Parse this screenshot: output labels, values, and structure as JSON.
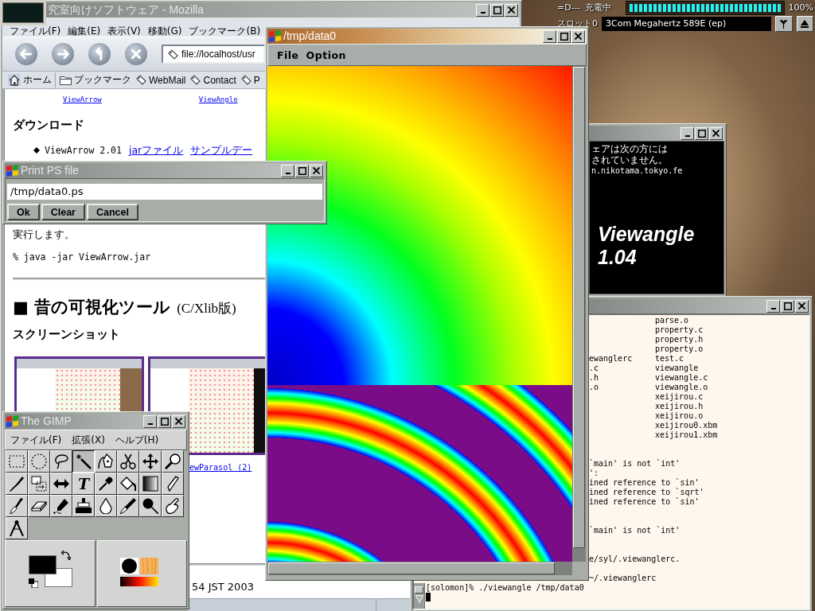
{
  "desktop": {
    "battery": {
      "label": "=D---",
      "status": "充電中",
      "level": 1,
      "reading": "100%"
    },
    "card_slot": {
      "label": "スロット0",
      "value": "3Com Megahertz 589E (ep)"
    }
  },
  "browser": {
    "title": "究室向けソフトウェア - Mozilla",
    "active": false,
    "menu": [
      "ファイル(F)",
      "編集(E)",
      "表示(V)",
      "移動(G)",
      "ブックマーク(B)"
    ],
    "url": "file://localhost/usr",
    "personal_toolbar": [
      {
        "label": "ホーム",
        "kind": "home"
      },
      {
        "label": "ブックマーク",
        "kind": "folder"
      },
      {
        "label": "WebMail",
        "kind": "bookmark"
      },
      {
        "label": "Contact",
        "kind": "bookmark"
      },
      {
        "label": "P",
        "kind": "bookmark"
      }
    ],
    "page": {
      "top_links": [
        "ViewArrow",
        "ViewAngle"
      ],
      "download_heading": "ダウンロード",
      "downloads": [
        {
          "name": "ViewArrow 2.01",
          "links": [
            "jarファイル",
            "サンプルデー"
          ]
        }
      ],
      "paragraph_end": "実行します。",
      "command": "% java -jar ViewArrow.jar",
      "section_heading": "■ 昔の可視化ツール",
      "section_heading_note": "(C/Xlib版)",
      "screenshots_heading": "スクリーンショット",
      "thumbnail_caption": "ewParasol (2)",
      "footer_fragment": "54 JST 2003"
    }
  },
  "splash": {
    "active": false,
    "lines": [
      "ェアは次の方には",
      "されていません。",
      "n.nikotama.tokyo.fe"
    ],
    "product": "Viewangle",
    "version": "1.04"
  },
  "terminal": {
    "active": false,
    "lines": [
      {
        "kind": "listing",
        "column_2": "parse.o"
      },
      {
        "kind": "listing",
        "column_2": "property.c"
      },
      {
        "kind": "listing",
        "column_2": "property.h"
      },
      {
        "kind": "listing",
        "column_2": "property.o"
      },
      {
        "kind": "listing",
        "column_1": "ewanglerc",
        "column_2": "test.c"
      },
      {
        "kind": "listing",
        "column_1": ".c",
        "column_2": "viewangle"
      },
      {
        "kind": "listing",
        "column_1": ".h",
        "column_2": "viewangle.c"
      },
      {
        "kind": "listing",
        "column_1": ".o",
        "column_2": "viewangle.o"
      },
      {
        "kind": "listing",
        "column_2": "xeijirou.c"
      },
      {
        "kind": "listing",
        "column_2": "xeijirou.h"
      },
      {
        "kind": "listing",
        "column_2": "xeijirou.o"
      },
      {
        "kind": "listing",
        "column_2": "xeijirou0.xbm"
      },
      {
        "kind": "listing",
        "column_2": "xeijirou1.xbm"
      },
      {
        "kind": "blank"
      },
      {
        "kind": "blank"
      },
      {
        "kind": "text",
        "text": "`main' is not `int'"
      },
      {
        "kind": "text",
        "text": "':"
      },
      {
        "kind": "text",
        "text": "ined reference to `sin'"
      },
      {
        "kind": "text",
        "text": "ined reference to `sqrt'"
      },
      {
        "kind": "text",
        "text": "ined reference to `sin'"
      },
      {
        "kind": "blank"
      },
      {
        "kind": "blank"
      },
      {
        "kind": "text",
        "text": "`main' is not `int'"
      },
      {
        "kind": "blank"
      },
      {
        "kind": "blank"
      },
      {
        "kind": "text",
        "text": "e/syl/.viewanglerc."
      },
      {
        "kind": "blank"
      },
      {
        "kind": "text",
        "text": "~/.viewanglerc"
      },
      {
        "kind": "prompt",
        "text": "[solomon]% ./viewangle /tmp/data0"
      },
      {
        "kind": "cursor"
      }
    ]
  },
  "viewer": {
    "title": "/tmp/data0",
    "active": true,
    "menu": [
      "File",
      "Option"
    ]
  },
  "print_dialog": {
    "title": "Print PS file",
    "active": false,
    "file": "/tmp/data0.ps",
    "buttons": [
      "Ok",
      "Clear",
      "Cancel"
    ]
  },
  "gimp": {
    "title": "The GIMP",
    "active": false,
    "menu": [
      "ファイル(F)",
      "拡張(X)",
      "ヘルプ(H)"
    ],
    "tools": [
      {
        "kind": "rect",
        "selected": false
      },
      {
        "kind": "ellipse",
        "selected": false
      },
      {
        "kind": "lasso",
        "selected": false
      },
      {
        "kind": "wand",
        "selected": true
      },
      {
        "kind": "bezier",
        "selected": false
      },
      {
        "kind": "scissors",
        "selected": false
      },
      {
        "kind": "move",
        "selected": false
      },
      {
        "kind": "magnify",
        "selected": false
      },
      {
        "kind": "crop",
        "selected": false
      },
      {
        "kind": "transform",
        "selected": false
      },
      {
        "kind": "flip",
        "selected": false
      },
      {
        "kind": "text",
        "glyph": "T",
        "selected": false
      },
      {
        "kind": "picker",
        "selected": false
      },
      {
        "kind": "bucket",
        "selected": false
      },
      {
        "kind": "blend",
        "selected": false
      },
      {
        "kind": "pencil",
        "selected": false
      },
      {
        "kind": "paintbrush",
        "selected": false
      },
      {
        "kind": "eraser",
        "selected": false
      },
      {
        "kind": "airbrush",
        "selected": false
      },
      {
        "kind": "clone",
        "selected": false
      },
      {
        "kind": "convolve",
        "selected": false
      },
      {
        "kind": "ink",
        "selected": false
      },
      {
        "kind": "dodgeburn",
        "selected": false
      },
      {
        "kind": "smudge",
        "selected": false
      },
      {
        "kind": "measure",
        "selected": false
      }
    ]
  }
}
